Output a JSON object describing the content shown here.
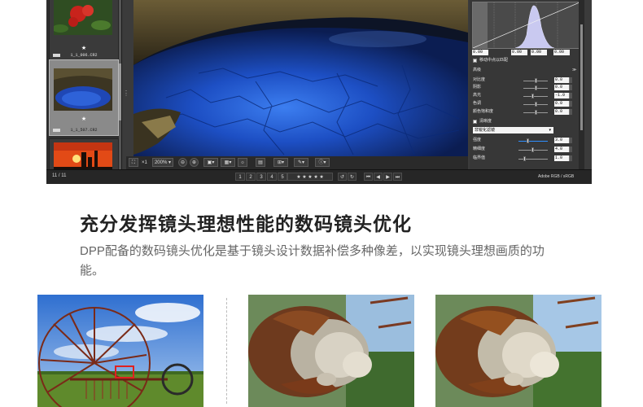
{
  "app": {
    "filmstrip": {
      "items": [
        {
          "star": "★",
          "name": "1_1_006.CR2",
          "selected": false
        },
        {
          "star": "★",
          "name": "1_1_507.CR2",
          "selected": true
        },
        {
          "star": "",
          "name": "",
          "selected": false
        }
      ]
    },
    "toolbar": {
      "zoom_factor": "×1",
      "zoom_value": "200%",
      "zoom_out": "⊖",
      "zoom_in": "⊕"
    },
    "status": {
      "count": "11 / 11",
      "ratings": [
        "1",
        "2",
        "3",
        "4",
        "5"
      ],
      "color_space": "Adobe RGB / sRGB"
    },
    "palette": {
      "histogram_values": [
        "0.00",
        "0.00",
        "0.00",
        "0.00",
        "0.00"
      ],
      "link_checkbox_label": "移动中点以匹配",
      "section_advanced": "高级",
      "adjustments": [
        {
          "label": "对比度",
          "value": "0.0"
        },
        {
          "label": "阴影",
          "value": "0.0"
        },
        {
          "label": "高光",
          "value": "-1.0"
        },
        {
          "label": "色调",
          "value": "0.0"
        },
        {
          "label": "颜色饱和度",
          "value": "0.0"
        }
      ],
      "sharpness_checkbox_label": "清晰度",
      "sharpness_mode": "非锐化滤镜",
      "sharpness": [
        {
          "label": "强度",
          "value": "3.0"
        },
        {
          "label": "精细度",
          "value": "4.0"
        },
        {
          "label": "临界值",
          "value": "1.0"
        }
      ]
    },
    "colors": {
      "accent": "#2e8fff"
    }
  },
  "heading": "充分发挥镜头理想性能的数码镜头优化",
  "description": "DPP配备的数码镜头优化是基于镜头设计数据补偿多种像差，以实现镜头理想画质的功能。"
}
